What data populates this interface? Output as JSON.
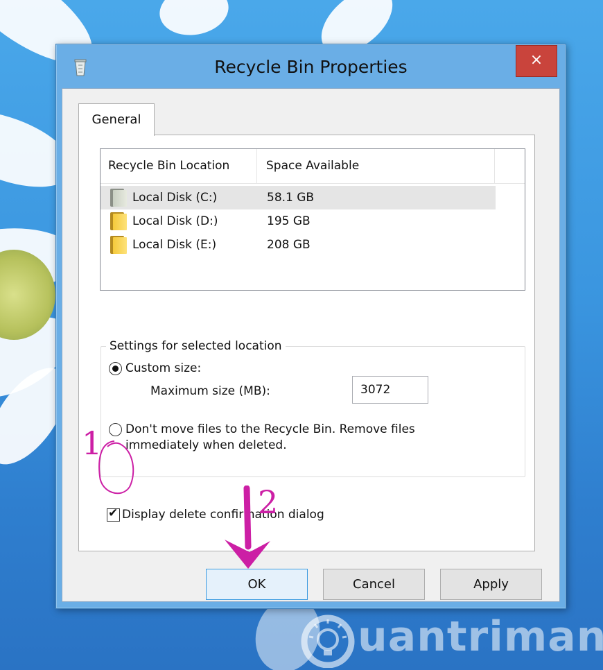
{
  "window": {
    "title": "Recycle Bin Properties",
    "close_label": "×"
  },
  "tabs": [
    {
      "label": "General"
    }
  ],
  "list": {
    "columns": [
      "Recycle Bin Location",
      "Space Available"
    ],
    "rows": [
      {
        "location": "Local Disk (C:)",
        "space": "58.1 GB",
        "selected": true
      },
      {
        "location": "Local Disk (D:)",
        "space": "195 GB",
        "selected": false
      },
      {
        "location": "Local Disk (E:)",
        "space": "208 GB",
        "selected": false
      }
    ]
  },
  "settings": {
    "group_label": "Settings for selected location",
    "custom_size_label": "Custom size:",
    "custom_size_selected": true,
    "max_size_label": "Maximum size (MB):",
    "max_size_value": "3072",
    "no_move_label_line1": "Don't move files to the Recycle Bin. Remove files",
    "no_move_label_line2": "immediately when deleted.",
    "no_move_selected": false
  },
  "confirm": {
    "label": "Display delete confirmation dialog",
    "checked": true
  },
  "buttons": {
    "ok": "OK",
    "cancel": "Cancel",
    "apply": "Apply"
  },
  "annotations": {
    "step1": "1",
    "step2": "2",
    "color": "#cc1fa5"
  },
  "watermark": {
    "text": "uantrimang"
  }
}
